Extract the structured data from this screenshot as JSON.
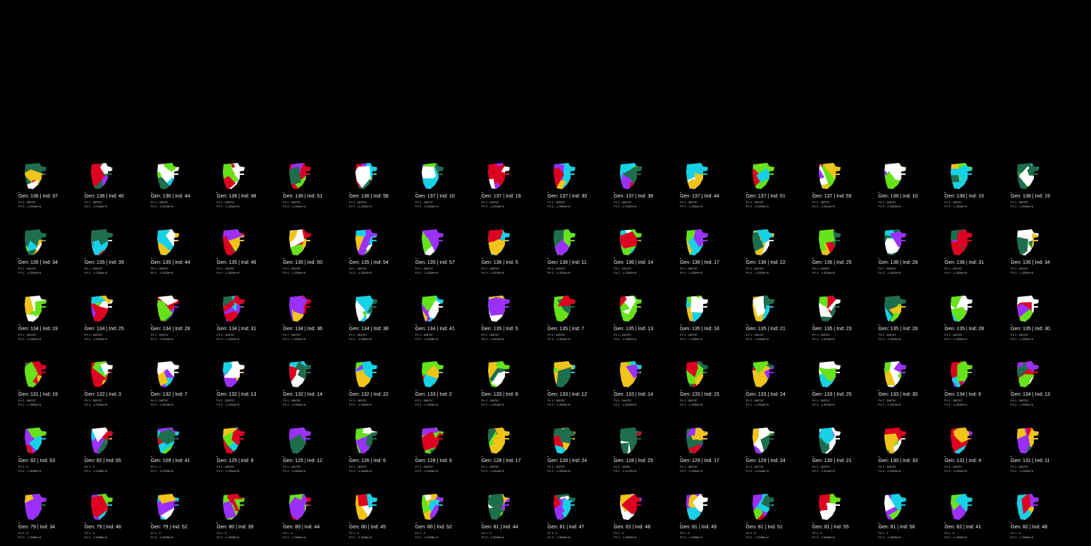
{
  "palette": [
    "#1e6e4e",
    "#ffffff",
    "#dd0020",
    "#9b30ff",
    "#17d1e6",
    "#66e21a",
    "#f0c419"
  ],
  "labels": {
    "gen_prefix": "Gen: ",
    "ind_separator": " | Ind: ",
    "fv1_prefix": "FV 1 : ",
    "fv2_prefix": "FV 2 : "
  },
  "rows": [
    [
      {
        "gen": 136,
        "ind": 37,
        "fv1": "269757",
        "fv2": "-1.3334e+6"
      },
      {
        "gen": 136,
        "ind": 40,
        "fv1": "269757",
        "fv2": "-1.3334e+6"
      },
      {
        "gen": 136,
        "ind": 44,
        "fv1": "269757",
        "fv2": "-1.3334e+6"
      },
      {
        "gen": 136,
        "ind": 48,
        "fv1": "269757",
        "fv2": "-1.3334e+6"
      },
      {
        "gen": 136,
        "ind": 51,
        "fv1": "269757",
        "fv2": "-1.3334e+6"
      },
      {
        "gen": 136,
        "ind": 58,
        "fv1": "269757",
        "fv2": "-1.3334e+6"
      },
      {
        "gen": 137,
        "ind": 10,
        "fv1": "269757",
        "fv2": "-1.3334e+6"
      },
      {
        "gen": 137,
        "ind": 19,
        "fv1": "269757",
        "fv2": "-1.3334e+6"
      },
      {
        "gen": 137,
        "ind": 30,
        "fv1": "269757",
        "fv2": "-1.3334e+6"
      },
      {
        "gen": 137,
        "ind": 38,
        "fv1": "269757",
        "fv2": "-1.3334e+6"
      },
      {
        "gen": 137,
        "ind": 44,
        "fv1": "269757",
        "fv2": "-1.3334e+6"
      },
      {
        "gen": 137,
        "ind": 51,
        "fv1": "269757",
        "fv2": "-1.3334e+6"
      },
      {
        "gen": 137,
        "ind": 55,
        "fv1": "269757",
        "fv2": "-1.3334e+6"
      },
      {
        "gen": 138,
        "ind": 10,
        "fv1": "269757",
        "fv2": "-1.3334e+6"
      },
      {
        "gen": 138,
        "ind": 15,
        "fv1": "269757",
        "fv2": "-1.3334e+6"
      },
      {
        "gen": 138,
        "ind": 19,
        "fv1": "269757",
        "fv2": "-1.3334e+6"
      }
    ],
    [
      {
        "gen": 135,
        "ind": 34,
        "fv1": "269757",
        "fv2": "-1.3334e+6"
      },
      {
        "gen": 135,
        "ind": 39,
        "fv1": "269757",
        "fv2": "-1.3334e+6"
      },
      {
        "gen": 135,
        "ind": 44,
        "fv1": "269757",
        "fv2": "-1.3334e+6"
      },
      {
        "gen": 135,
        "ind": 46,
        "fv1": "269757",
        "fv2": "-1.3334e+6"
      },
      {
        "gen": 135,
        "ind": 50,
        "fv1": "269757",
        "fv2": "-1.3334e+6"
      },
      {
        "gen": 135,
        "ind": 54,
        "fv1": "269757",
        "fv2": "-1.3334e+6"
      },
      {
        "gen": 135,
        "ind": 57,
        "fv1": "269757",
        "fv2": "-1.3334e+6"
      },
      {
        "gen": 136,
        "ind": 5,
        "fv1": "269757",
        "fv2": "-1.3334e+6"
      },
      {
        "gen": 136,
        "ind": 11,
        "fv1": "269757",
        "fv2": "-1.3334e+6"
      },
      {
        "gen": 136,
        "ind": 14,
        "fv1": "269757",
        "fv2": "-1.3334e+6"
      },
      {
        "gen": 136,
        "ind": 17,
        "fv1": "269757",
        "fv2": "-1.3334e+6"
      },
      {
        "gen": 136,
        "ind": 22,
        "fv1": "269757",
        "fv2": "-1.3334e+6"
      },
      {
        "gen": 136,
        "ind": 25,
        "fv1": "269757",
        "fv2": "-1.3334e+6"
      },
      {
        "gen": 136,
        "ind": 28,
        "fv1": "269757",
        "fv2": "-1.3334e+6"
      },
      {
        "gen": 136,
        "ind": 31,
        "fv1": "269757",
        "fv2": "-1.3334e+6"
      },
      {
        "gen": 136,
        "ind": 34,
        "fv1": "269757",
        "fv2": "-1.3334e+6"
      }
    ],
    [
      {
        "gen": 134,
        "ind": 19,
        "fv1": "269757",
        "fv2": "-1.3334e+6"
      },
      {
        "gen": 134,
        "ind": 25,
        "fv1": "269757",
        "fv2": "-1.3334e+6"
      },
      {
        "gen": 134,
        "ind": 28,
        "fv1": "269757",
        "fv2": "-1.3334e+6"
      },
      {
        "gen": 134,
        "ind": 31,
        "fv1": "269757",
        "fv2": "-1.3334e+6"
      },
      {
        "gen": 134,
        "ind": 36,
        "fv1": "269757",
        "fv2": "-1.3334e+6"
      },
      {
        "gen": 134,
        "ind": 38,
        "fv1": "269757",
        "fv2": "-1.3334e+6"
      },
      {
        "gen": 134,
        "ind": 41,
        "fv1": "269757",
        "fv2": "-1.3334e+6"
      },
      {
        "gen": 135,
        "ind": 5,
        "fv1": "269757",
        "fv2": "-1.3334e+6"
      },
      {
        "gen": 135,
        "ind": 7,
        "fv1": "269757",
        "fv2": "-1.3334e+6"
      },
      {
        "gen": 135,
        "ind": 13,
        "fv1": "269757",
        "fv2": "-1.3334e+6"
      },
      {
        "gen": 135,
        "ind": 18,
        "fv1": "269757",
        "fv2": "-1.3334e+6"
      },
      {
        "gen": 135,
        "ind": 21,
        "fv1": "269757",
        "fv2": "-1.3334e+6"
      },
      {
        "gen": 135,
        "ind": 23,
        "fv1": "269757",
        "fv2": "-1.3334e+6"
      },
      {
        "gen": 135,
        "ind": 26,
        "fv1": "269757",
        "fv2": "-1.3334e+6"
      },
      {
        "gen": 135,
        "ind": 28,
        "fv1": "269757",
        "fv2": "-1.3334e+6"
      },
      {
        "gen": 135,
        "ind": 30,
        "fv1": "269757",
        "fv2": "-1.3334e+6"
      }
    ],
    [
      {
        "gen": 131,
        "ind": 19,
        "fv1": "269757",
        "fv2": "-1.3334e+6"
      },
      {
        "gen": 132,
        "ind": 3,
        "fv1": "269757",
        "fv2": "-1.3334e+6"
      },
      {
        "gen": 132,
        "ind": 7,
        "fv1": "269757",
        "fv2": "-1.3334e+6"
      },
      {
        "gen": 132,
        "ind": 13,
        "fv1": "269757",
        "fv2": "-1.3334e+6"
      },
      {
        "gen": 132,
        "ind": 14,
        "fv1": "269757",
        "fv2": "-1.3334e+6"
      },
      {
        "gen": 132,
        "ind": 22,
        "fv1": "269757",
        "fv2": "-1.3334e+6"
      },
      {
        "gen": 133,
        "ind": 2,
        "fv1": "269757",
        "fv2": "-1.3334e+6"
      },
      {
        "gen": 133,
        "ind": 8,
        "fv1": "269757",
        "fv2": "-1.3334e+6"
      },
      {
        "gen": 133,
        "ind": 12,
        "fv1": "269757",
        "fv2": "-1.3334e+6"
      },
      {
        "gen": 133,
        "ind": 14,
        "fv1": "269757",
        "fv2": "-1.3334e+6"
      },
      {
        "gen": 133,
        "ind": 15,
        "fv1": "269757",
        "fv2": "-1.3334e+6"
      },
      {
        "gen": 133,
        "ind": 24,
        "fv1": "269757",
        "fv2": "-1.3334e+6"
      },
      {
        "gen": 133,
        "ind": 25,
        "fv1": "269757",
        "fv2": "-1.3334e+6"
      },
      {
        "gen": 133,
        "ind": 30,
        "fv1": "269757",
        "fv2": "-1.3334e+6"
      },
      {
        "gen": 134,
        "ind": 6,
        "fv1": "269757",
        "fv2": "-1.3334e+6"
      },
      {
        "gen": 134,
        "ind": 13,
        "fv1": "269757",
        "fv2": "-1.3334e+6"
      }
    ],
    [
      {
        "gen": 82,
        "ind": 53,
        "fv1": "0",
        "fv2": "-1.3098e+6"
      },
      {
        "gen": 82,
        "ind": 55,
        "fv1": "0",
        "fv2": "-1.3098e+6"
      },
      {
        "gen": 109,
        "ind": 41,
        "fv1": "0",
        "fv2": "-1.3159e+6"
      },
      {
        "gen": 125,
        "ind": 6,
        "fv1": "269757",
        "fv2": "-1.3334e+6"
      },
      {
        "gen": 125,
        "ind": 12,
        "fv1": "269757",
        "fv2": "-1.3334e+6"
      },
      {
        "gen": 126,
        "ind": 6,
        "fv1": "269757",
        "fv2": "-1.3334e+6"
      },
      {
        "gen": 128,
        "ind": 9,
        "fv1": "269757",
        "fv2": "-1.3334e+6"
      },
      {
        "gen": 128,
        "ind": 17,
        "fv1": "269757",
        "fv2": "-1.3334e+6"
      },
      {
        "gen": 128,
        "ind": 24,
        "fv1": "269757",
        "fv2": "-1.3334e+6"
      },
      {
        "gen": 128,
        "ind": 25,
        "fv1": "16832",
        "fv2": "-1.3179e+6"
      },
      {
        "gen": 129,
        "ind": 17,
        "fv1": "269757",
        "fv2": "-1.3334e+6"
      },
      {
        "gen": 129,
        "ind": 24,
        "fv1": "269757",
        "fv2": "-1.3334e+6"
      },
      {
        "gen": 130,
        "ind": 21,
        "fv1": "269757",
        "fv2": "-1.3334e+6"
      },
      {
        "gen": 130,
        "ind": 33,
        "fv1": "269757",
        "fv2": "-1.3334e+6"
      },
      {
        "gen": 131,
        "ind": 4,
        "fv1": "269757",
        "fv2": "-1.3334e+6"
      },
      {
        "gen": 131,
        "ind": 11,
        "fv1": "269757",
        "fv2": "-1.3334e+6"
      }
    ],
    [
      {
        "gen": 79,
        "ind": 34,
        "fv1": "0",
        "fv2": "-1.3098e+6"
      },
      {
        "gen": 79,
        "ind": 48,
        "fv1": "0",
        "fv2": "-1.3098e+6"
      },
      {
        "gen": 79,
        "ind": 52,
        "fv1": "0",
        "fv2": "-1.3098e+6"
      },
      {
        "gen": 80,
        "ind": 39,
        "fv1": "0",
        "fv2": "-1.3098e+6"
      },
      {
        "gen": 80,
        "ind": 44,
        "fv1": "0",
        "fv2": "-1.3098e+6"
      },
      {
        "gen": 80,
        "ind": 45,
        "fv1": "0",
        "fv2": "-1.3098e+6"
      },
      {
        "gen": 80,
        "ind": 52,
        "fv1": "0",
        "fv2": "-1.3098e+6"
      },
      {
        "gen": 81,
        "ind": 44,
        "fv1": "0",
        "fv2": "-1.3098e+6"
      },
      {
        "gen": 81,
        "ind": 47,
        "fv1": "0",
        "fv2": "-1.3098e+6"
      },
      {
        "gen": 81,
        "ind": 48,
        "fv1": "0",
        "fv2": "-1.3098e+6"
      },
      {
        "gen": 81,
        "ind": 49,
        "fv1": "0",
        "fv2": "-1.3098e+6"
      },
      {
        "gen": 81,
        "ind": 51,
        "fv1": "0",
        "fv2": "-1.3098e+6"
      },
      {
        "gen": 81,
        "ind": 55,
        "fv1": "0",
        "fv2": "-1.3098e+6"
      },
      {
        "gen": 81,
        "ind": 56,
        "fv1": "0",
        "fv2": "-1.3098e+6"
      },
      {
        "gen": 82,
        "ind": 41,
        "fv1": "0",
        "fv2": "-1.3098e+6"
      },
      {
        "gen": 82,
        "ind": 48,
        "fv1": "0",
        "fv2": "-1.3098e+6"
      }
    ]
  ]
}
